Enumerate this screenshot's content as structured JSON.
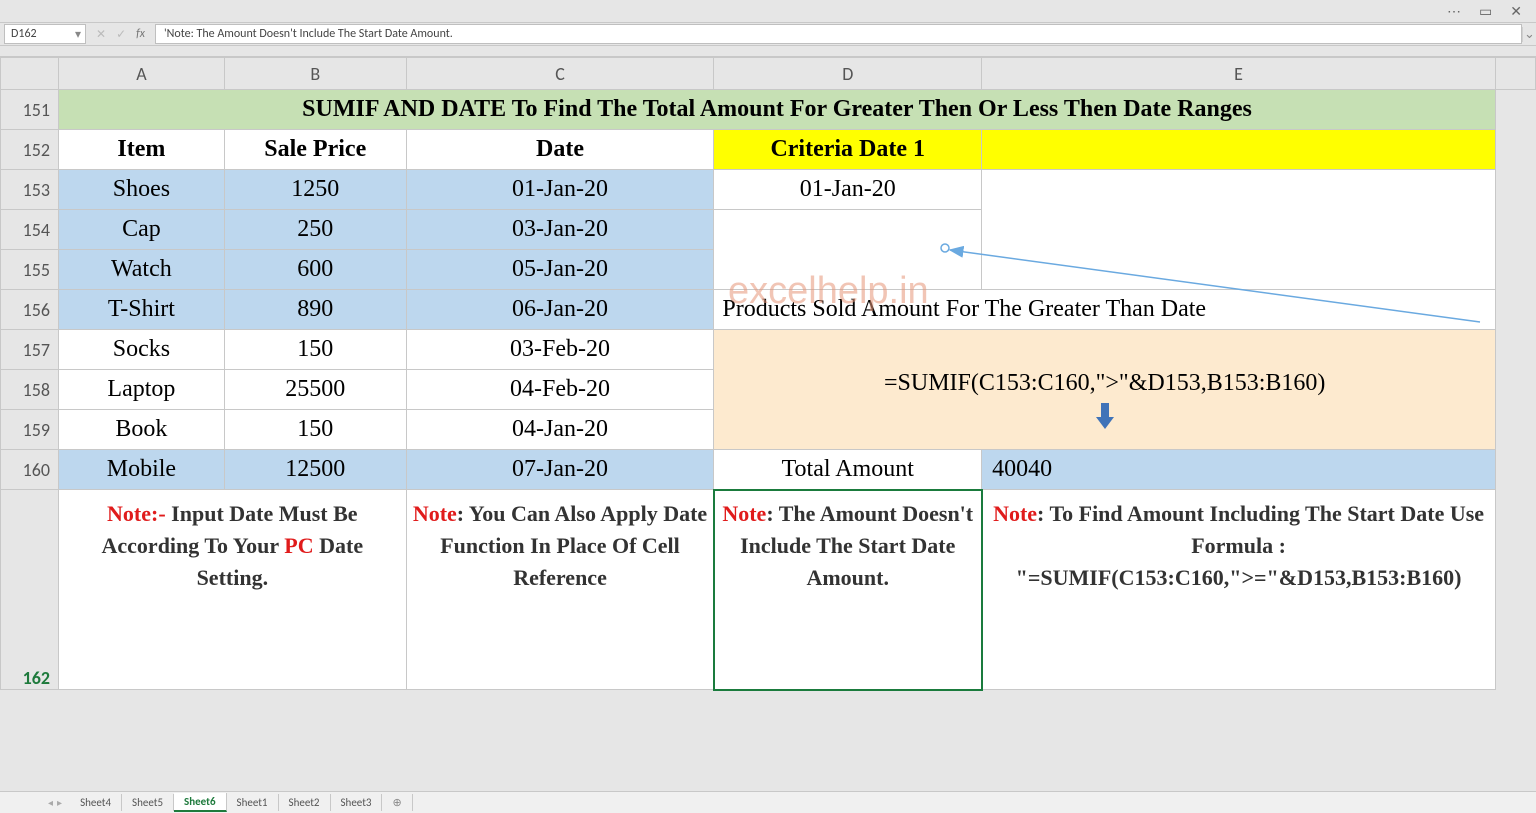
{
  "nameBox": "D162",
  "formulaBarText": "'Note: The Amount Doesn't Include The Start Date Amount.",
  "colHeaders": [
    "A",
    "B",
    "C",
    "D",
    "E"
  ],
  "rowHeaders": [
    151,
    152,
    153,
    154,
    155,
    156,
    157,
    158,
    159,
    160,
    162
  ],
  "title": "SUMIF AND DATE To Find The Total Amount For Greater Then Or Less Then Date Ranges",
  "headerRow": {
    "A": "Item",
    "B": "Sale Price",
    "C": "Date",
    "D": "Criteria Date 1",
    "E": ""
  },
  "data": [
    {
      "item": "Shoes",
      "price": "1250",
      "date": "01-Jan-20",
      "blue": true
    },
    {
      "item": "Cap",
      "price": "250",
      "date": "03-Jan-20",
      "blue": true
    },
    {
      "item": "Watch",
      "price": "600",
      "date": "05-Jan-20",
      "blue": true
    },
    {
      "item": "T-Shirt",
      "price": "890",
      "date": "06-Jan-20",
      "blue": true
    },
    {
      "item": "Socks",
      "price": "150",
      "date": "03-Feb-20",
      "blue": false
    },
    {
      "item": "Laptop",
      "price": "25500",
      "date": "04-Feb-20",
      "blue": false
    },
    {
      "item": "Book",
      "price": "150",
      "date": "04-Jan-20",
      "blue": false
    },
    {
      "item": "Mobile",
      "price": "12500",
      "date": "07-Jan-20",
      "blue": true
    }
  ],
  "criteriaDate": "01-Jan-20",
  "bigLabel": "Products Sold Amount For The Greater Than Date",
  "formulaText": "=SUMIF(C153:C160,\">\"&D153,B153:B160)",
  "totalLabel": "Total Amount",
  "totalValue": "40040",
  "watermark": "excelhelp.in",
  "notes": {
    "AB_pre": "Note:-",
    "AB_body": " Input Date Must Be According To Your ",
    "AB_red2": "PC",
    "AB_tail": " Date Setting.",
    "C_pre": "Note",
    "C_body": ": You Can Also Apply Date Function In Place Of Cell Reference",
    "D_pre": "Note",
    "D_body": ": The Amount Doesn't Include The Start Date Amount.",
    "E_pre": "Note",
    "E_body": ": To Find Amount Including The Start Date Use Formula : \"=SUMIF(C153:C160,\">=\"&D153,B153:B160)"
  },
  "tabs": [
    "Sheet4",
    "Sheet5",
    "Sheet6",
    "Sheet1",
    "Sheet2",
    "Sheet3"
  ],
  "activeTab": "Sheet6",
  "chart_data": {
    "type": "table",
    "title": "SUMIF AND DATE To Find The Total Amount For Greater Then Or Less Then Date Ranges",
    "columns": [
      "Item",
      "Sale Price",
      "Date"
    ],
    "rows": [
      [
        "Shoes",
        1250,
        "01-Jan-20"
      ],
      [
        "Cap",
        250,
        "03-Jan-20"
      ],
      [
        "Watch",
        600,
        "05-Jan-20"
      ],
      [
        "T-Shirt",
        890,
        "06-Jan-20"
      ],
      [
        "Socks",
        150,
        "03-Feb-20"
      ],
      [
        "Laptop",
        25500,
        "04-Feb-20"
      ],
      [
        "Book",
        150,
        "04-Jan-20"
      ],
      [
        "Mobile",
        12500,
        "07-Jan-20"
      ]
    ],
    "criteria_date": "01-Jan-20",
    "formula": "=SUMIF(C153:C160,\">\"&D153,B153:B160)",
    "result": 40040
  }
}
